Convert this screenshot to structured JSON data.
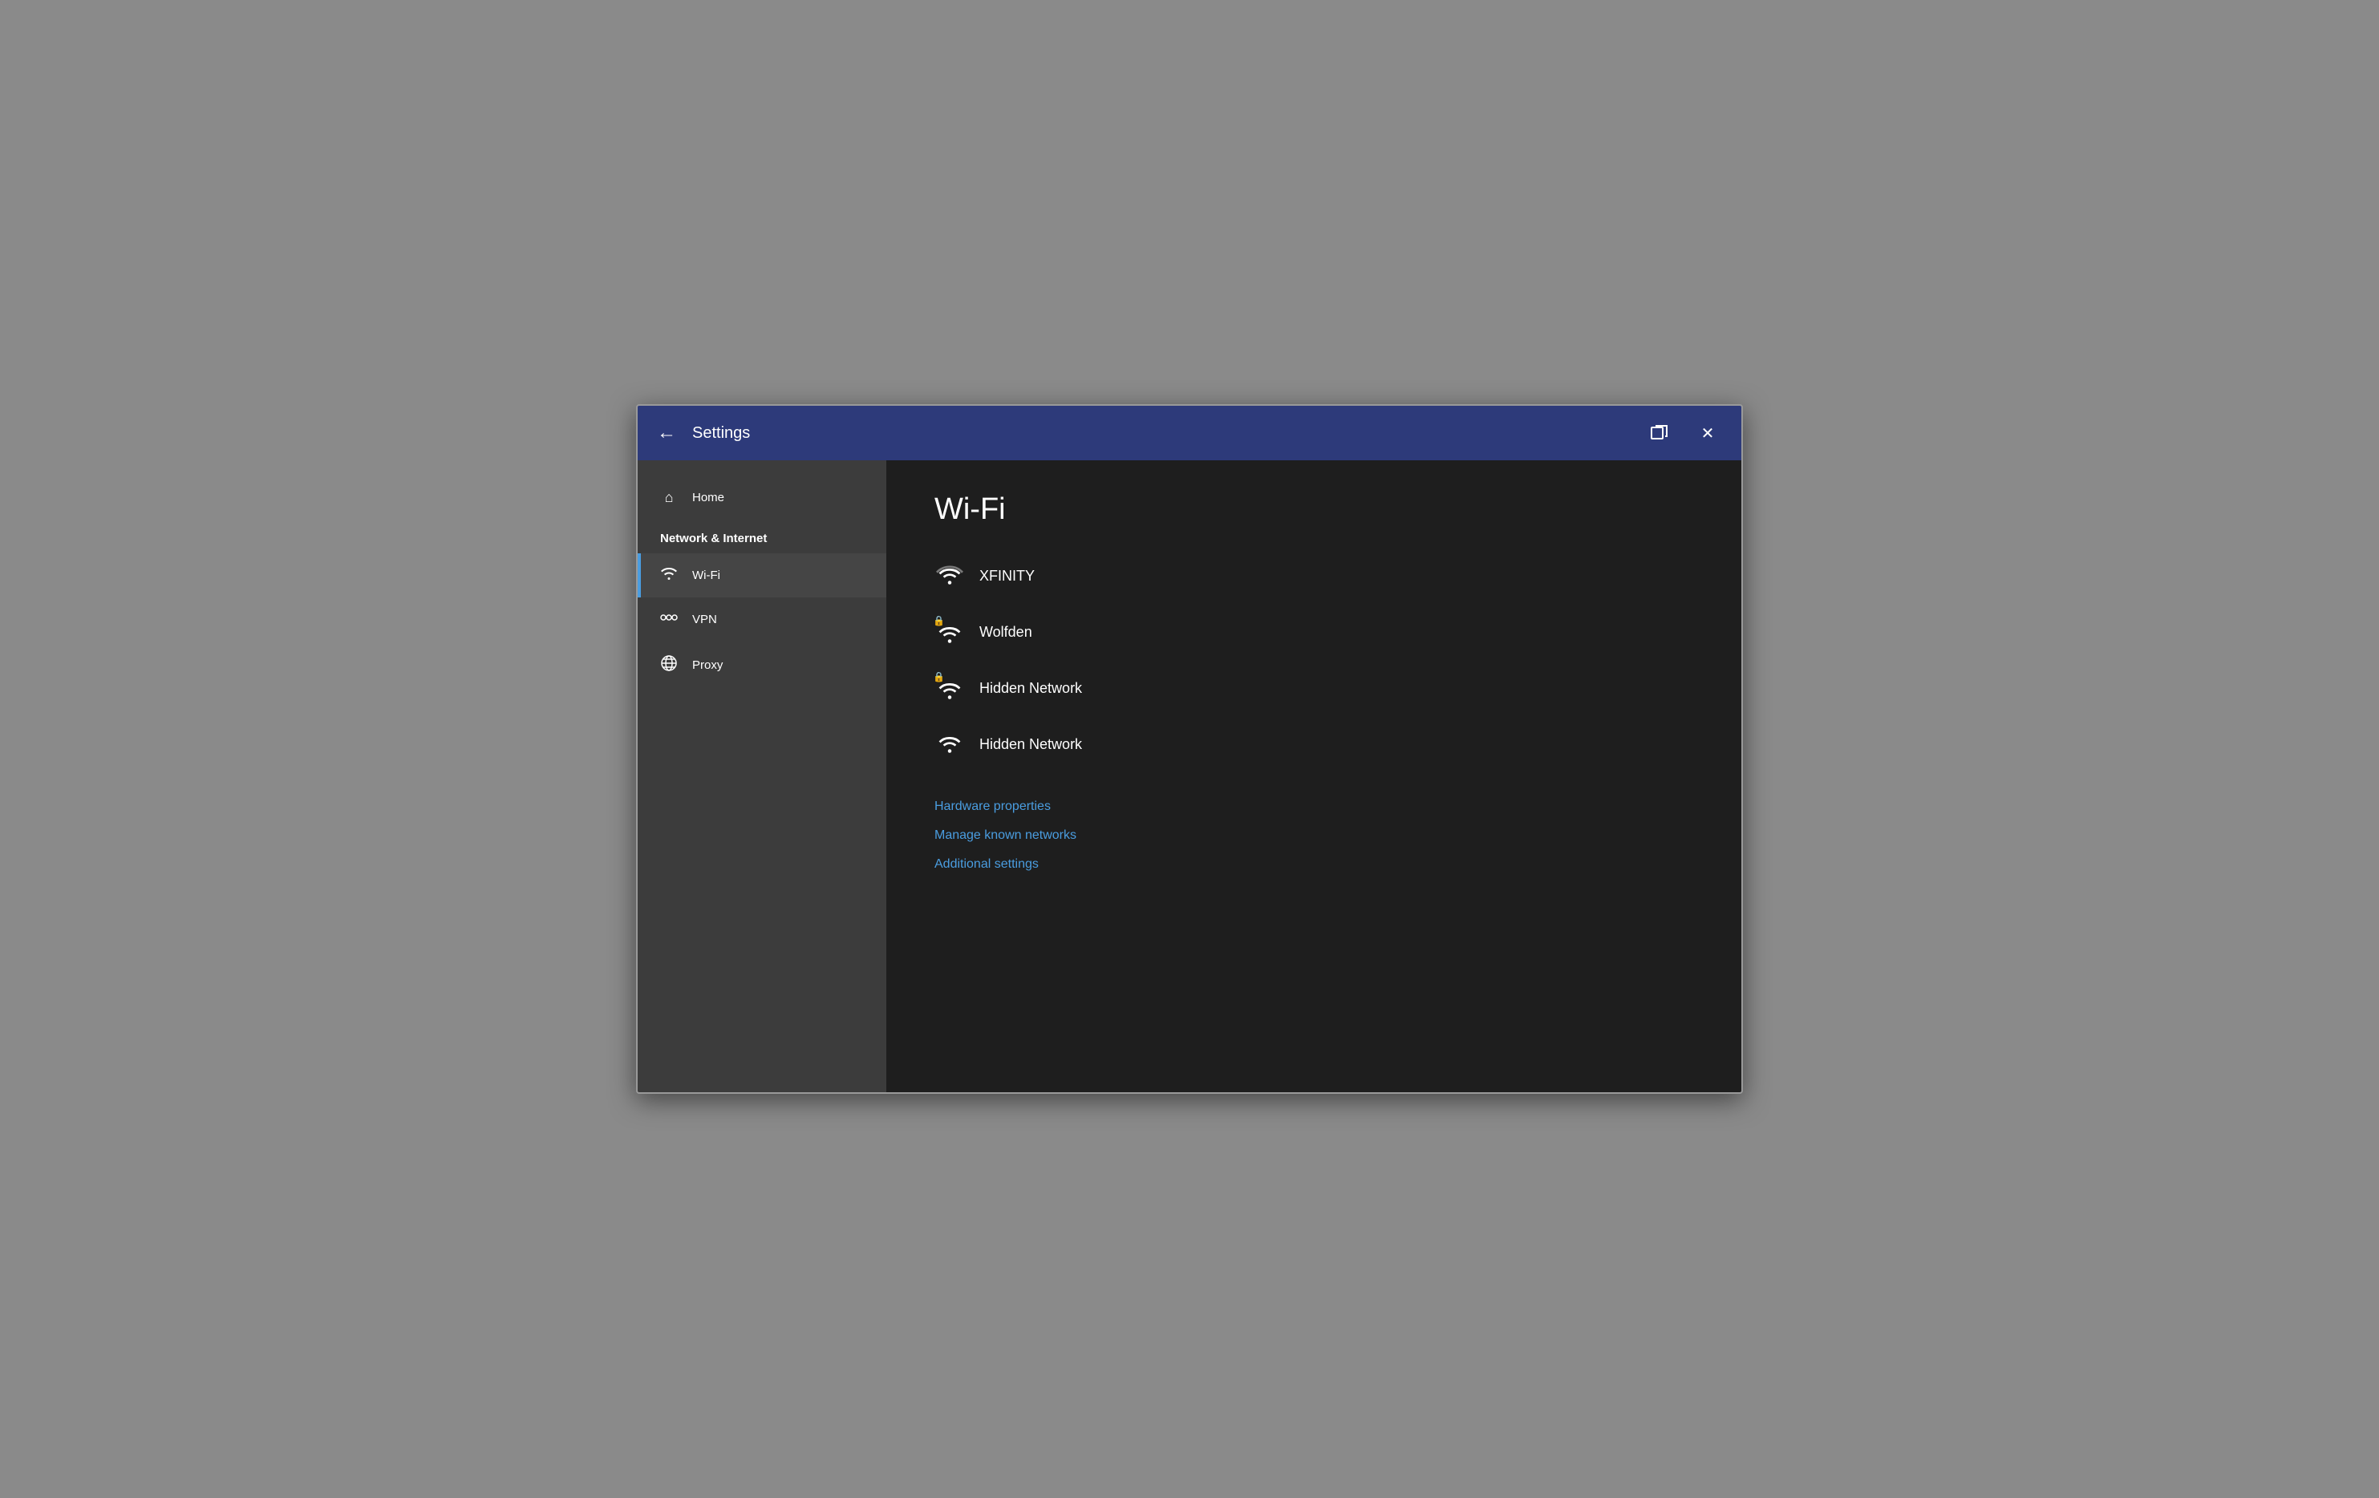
{
  "titlebar": {
    "title": "Settings",
    "back_label": "←",
    "restore_label": "⧉",
    "close_label": "✕"
  },
  "sidebar": {
    "home_label": "Home",
    "section_label": "Network & Internet",
    "items": [
      {
        "id": "wifi",
        "label": "Wi-Fi",
        "icon": "wifi",
        "active": true
      },
      {
        "id": "vpn",
        "label": "VPN",
        "icon": "vpn",
        "active": false
      },
      {
        "id": "proxy",
        "label": "Proxy",
        "icon": "proxy",
        "active": false
      }
    ]
  },
  "content": {
    "page_title": "Wi-Fi",
    "networks": [
      {
        "name": "XFINITY",
        "secured": false
      },
      {
        "name": "Wolfden",
        "secured": true
      },
      {
        "name": "Hidden Network",
        "secured": true
      },
      {
        "name": "Hidden Network",
        "secured": false
      }
    ],
    "links": [
      {
        "label": "Hardware properties"
      },
      {
        "label": "Manage known networks"
      },
      {
        "label": "Additional settings"
      }
    ]
  }
}
